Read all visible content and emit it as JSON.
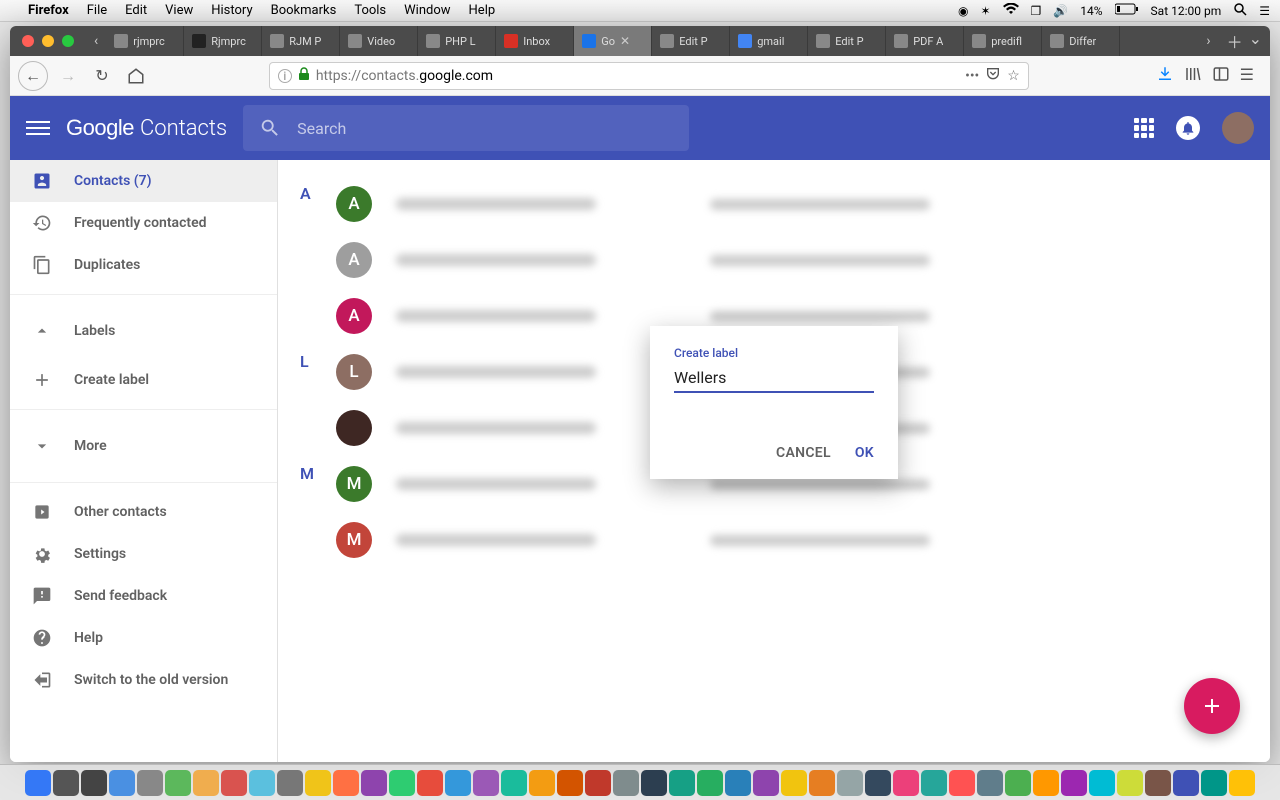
{
  "mac_menu": {
    "app": "Firefox",
    "items": [
      "File",
      "Edit",
      "View",
      "History",
      "Bookmarks",
      "Tools",
      "Window",
      "Help"
    ],
    "battery": "14%",
    "clock": "Sat 12:00 pm"
  },
  "tabs": [
    {
      "label": "rjmprc",
      "fav": "#888"
    },
    {
      "label": "Rjmprc",
      "fav": "#222"
    },
    {
      "label": "RJM P",
      "fav": "#888"
    },
    {
      "label": "Video",
      "fav": "#888"
    },
    {
      "label": "PHP L",
      "fav": "#888"
    },
    {
      "label": "Inbox",
      "fav": "#d93025"
    },
    {
      "label": "Go",
      "fav": "#1a73e8",
      "active": true,
      "closable": true
    },
    {
      "label": "Edit P",
      "fav": "#888"
    },
    {
      "label": "gmail",
      "fav": "#4285f4"
    },
    {
      "label": "Edit P",
      "fav": "#888"
    },
    {
      "label": "PDF A",
      "fav": "#888"
    },
    {
      "label": "predifl",
      "fav": "#888"
    },
    {
      "label": "Differ",
      "fav": "#888"
    }
  ],
  "url": {
    "prefix": "https://contacts.",
    "domain": "google.com"
  },
  "header": {
    "logo_google": "Google",
    "logo_contacts": "Contacts",
    "search_placeholder": "Search"
  },
  "sidebar": {
    "contacts": "Contacts (7)",
    "frequent": "Frequently contacted",
    "duplicates": "Duplicates",
    "labels": "Labels",
    "create_label": "Create label",
    "more": "More",
    "other": "Other contacts",
    "settings": "Settings",
    "feedback": "Send feedback",
    "help": "Help",
    "switch": "Switch to the old version"
  },
  "contacts": {
    "groups": [
      {
        "letter": "A",
        "rows": [
          {
            "initial": "A",
            "color": "#3b7a2b"
          },
          {
            "initial": "A",
            "color": "#9e9e9e"
          },
          {
            "initial": "A",
            "color": "#c2185b"
          }
        ]
      },
      {
        "letter": "L",
        "rows": [
          {
            "initial": "L",
            "color": "#8d6e63"
          },
          {
            "initial": "",
            "color": "#3e2723",
            "img": true
          }
        ]
      },
      {
        "letter": "M",
        "rows": [
          {
            "initial": "M",
            "color": "#3b7a2b"
          },
          {
            "initial": "M",
            "color": "#c2453a"
          }
        ]
      }
    ]
  },
  "dialog": {
    "title": "Create label",
    "value": "Wellers",
    "cancel": "CANCEL",
    "ok": "OK"
  },
  "dock_colors": [
    "#3478f6",
    "#555",
    "#444",
    "#4a90e2",
    "#888",
    "#5cb85c",
    "#f0ad4e",
    "#d9534f",
    "#5bc0de",
    "#777",
    "#f0c419",
    "#ff7043",
    "#8e44ad",
    "#2ecc71",
    "#e74c3c",
    "#3498db",
    "#9b59b6",
    "#1abc9c",
    "#f39c12",
    "#d35400",
    "#c0392b",
    "#7f8c8d",
    "#2c3e50",
    "#16a085",
    "#27ae60",
    "#2980b9",
    "#8e44ad",
    "#f1c40f",
    "#e67e22",
    "#95a5a6",
    "#34495e",
    "#ec407a",
    "#26a69a",
    "#ff5252",
    "#607d8b",
    "#4caf50",
    "#ff9800",
    "#9c27b0",
    "#00bcd4",
    "#cddc39",
    "#795548",
    "#3f51b5",
    "#009688",
    "#ffc107"
  ]
}
